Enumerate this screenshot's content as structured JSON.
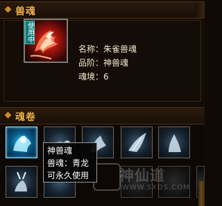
{
  "beast_soul_panel": {
    "header": "兽魂",
    "equipped": {
      "badge": "使用中",
      "icon": "vermilion-bird-icon",
      "name_line": "名称：朱雀兽魂",
      "grade_line": "品阶：神兽魂",
      "level_line": "魂境：6"
    }
  },
  "soul_scroll": {
    "header": "魂卷",
    "slots": [
      {
        "icon": "ice-lion-icon",
        "state": "selected"
      },
      {
        "icon": "white-tiger-icon",
        "state": "normal"
      },
      {
        "icon": "spirit-horse-icon",
        "state": "normal"
      },
      {
        "icon": "spirit-wings-icon",
        "state": "normal"
      },
      {
        "icon": "spirit-wolf-icon",
        "state": "normal"
      },
      {
        "icon": "spirit-deer-icon",
        "state": "normal"
      },
      {
        "icon": "azure-dragon-icon",
        "state": "normal"
      },
      {
        "icon": "phoenix-icon",
        "state": "dim"
      },
      {
        "icon": "shadow-beast-icon",
        "state": "dim"
      },
      {
        "icon": "shadow-beast-icon",
        "state": "dim"
      }
    ],
    "tooltip": {
      "line1": "神兽魂",
      "line2": "兽魂：青龙",
      "line3": "可永久使用"
    }
  },
  "watermark": {
    "text": "神仙道",
    "url": "WWW.SXDS.COM"
  },
  "colors": {
    "header_text": "#f0b248",
    "body_text": "#f2e7cf",
    "badge_bg": "#0d7a7a",
    "selected_slot_glow": "#5fd3ff"
  }
}
